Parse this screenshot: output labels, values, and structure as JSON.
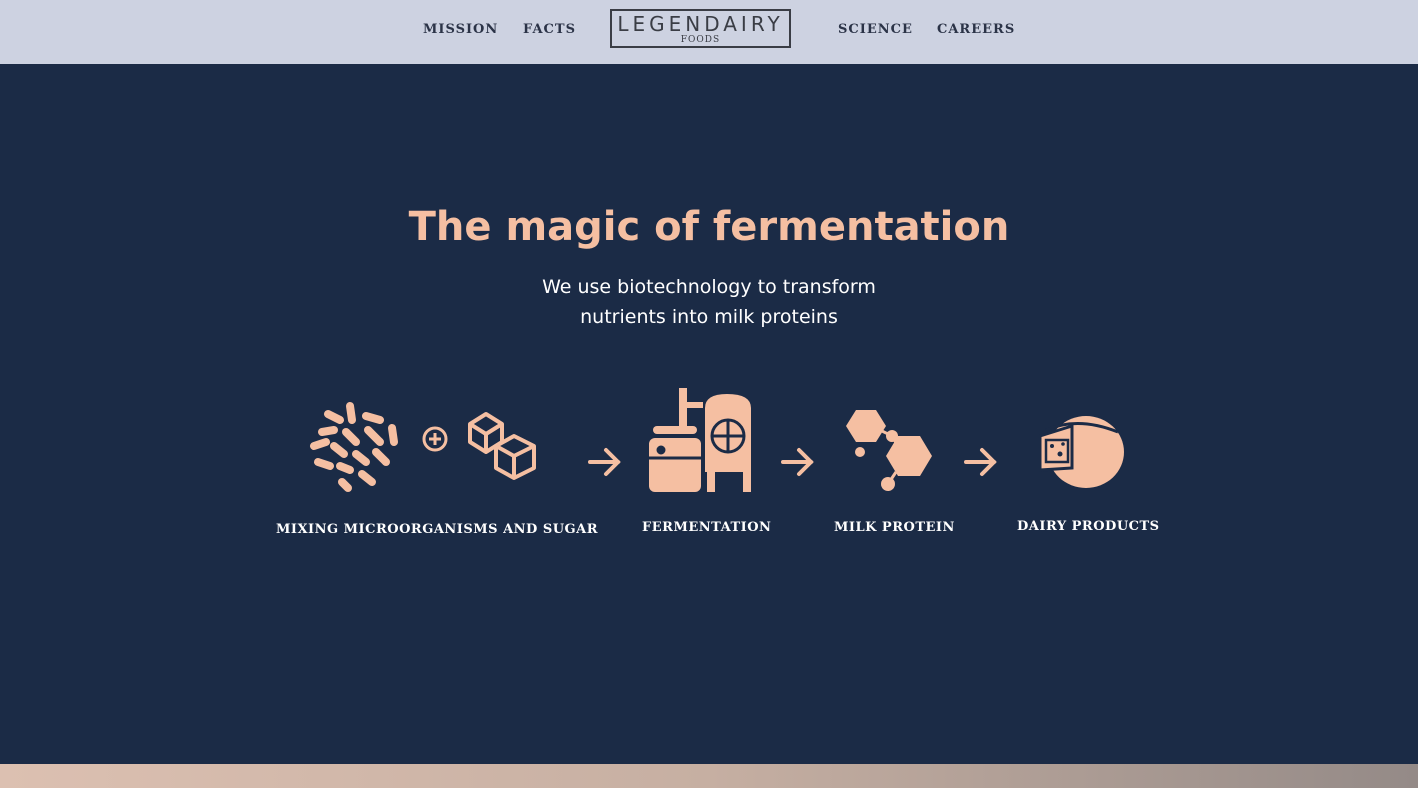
{
  "nav": {
    "left": [
      "MISSION",
      "FACTS"
    ],
    "right": [
      "SCIENCE",
      "CAREERS"
    ],
    "logo": {
      "main": "LEGENDAIRY",
      "sub": "FOODS"
    }
  },
  "hero": {
    "title": "The magic of fermentation",
    "subtitle_lines": [
      "We use biotechnology to transform",
      "nutrients into milk proteins"
    ]
  },
  "steps": [
    {
      "label": "MIXING MICROORGANISMS AND SUGAR",
      "icons": [
        "microorganisms-icon",
        "plus-icon",
        "sugar-cubes-icon"
      ]
    },
    {
      "label": "FERMENTATION",
      "icons": [
        "fermentation-tank-icon"
      ]
    },
    {
      "label": "MILK PROTEIN",
      "icons": [
        "molecule-icon"
      ]
    },
    {
      "label": "DAIRY PRODUCTS",
      "icons": [
        "cheese-wheel-icon"
      ]
    }
  ],
  "colors": {
    "background": "#1b2b46",
    "nav_background": "#cdd2e1",
    "accent": "#f5bfa2",
    "text": "#ffffff"
  }
}
